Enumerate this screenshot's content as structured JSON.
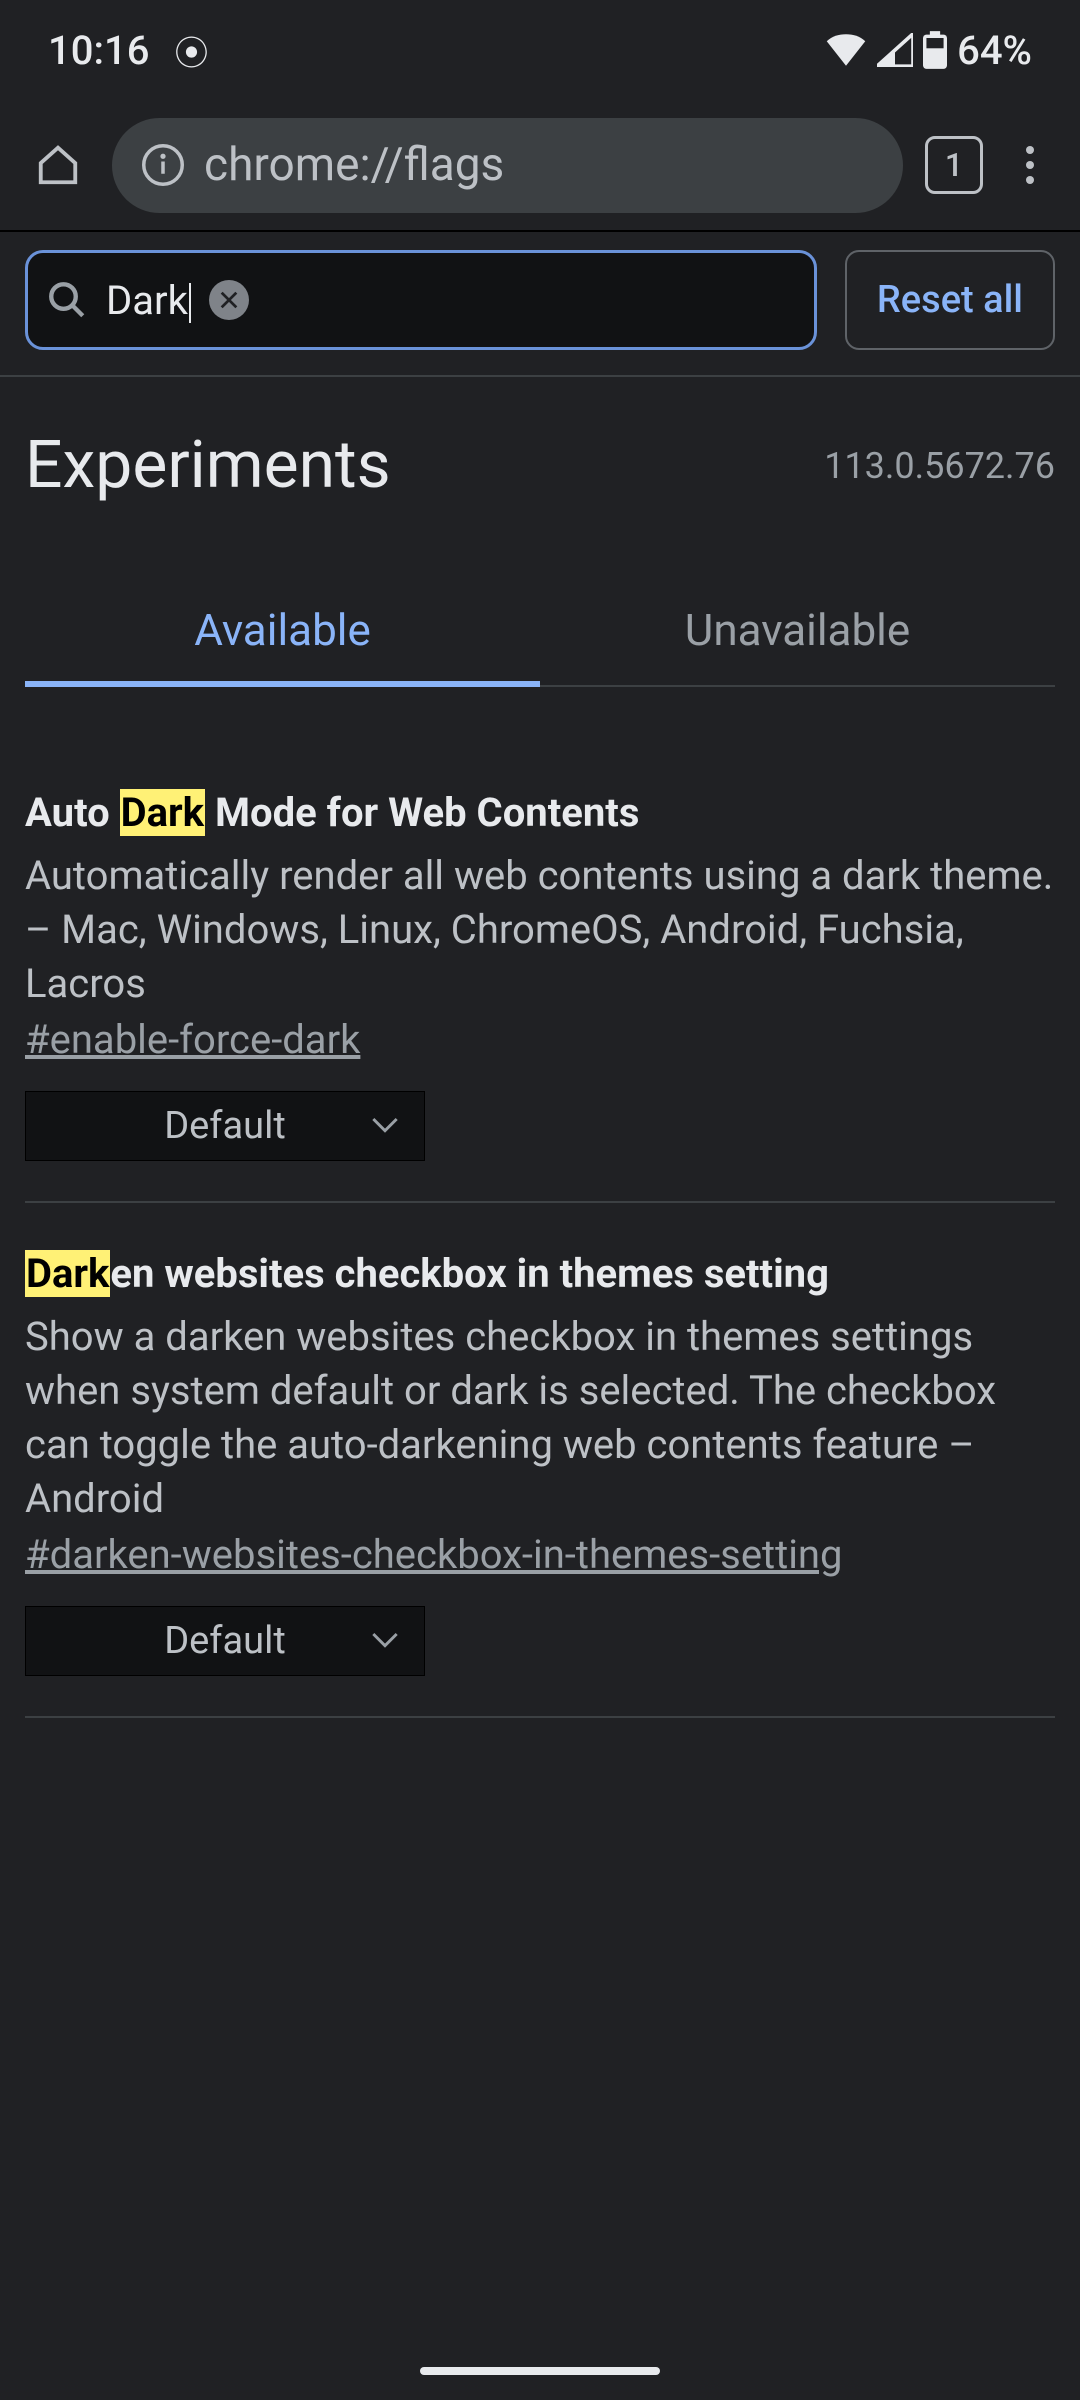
{
  "status_bar": {
    "time": "10:16",
    "battery_text": "64%"
  },
  "browser": {
    "url": "chrome://flags",
    "tab_count": "1"
  },
  "search": {
    "value": "Dark",
    "reset_label": "Reset all"
  },
  "header": {
    "title": "Experiments",
    "version": "113.0.5672.76"
  },
  "tabs": {
    "available": "Available",
    "unavailable": "Unavailable"
  },
  "flags": [
    {
      "title_pre": "Auto ",
      "title_hl": "Dark",
      "title_post": " Mode for Web Contents",
      "desc": "Automatically render all web contents using a dark theme. – Mac, Windows, Linux, ChromeOS, Android, Fuchsia, Lacros",
      "anchor": "#enable-force-dark",
      "select": "Default"
    },
    {
      "title_pre": "",
      "title_hl": "Dark",
      "title_post": "en websites checkbox in themes setting",
      "desc": "Show a darken websites checkbox in themes settings when system default or dark is selected. The checkbox can toggle the auto-darkening web contents feature – Android",
      "anchor": "#darken-websites-checkbox-in-themes-setting",
      "select": "Default"
    }
  ]
}
